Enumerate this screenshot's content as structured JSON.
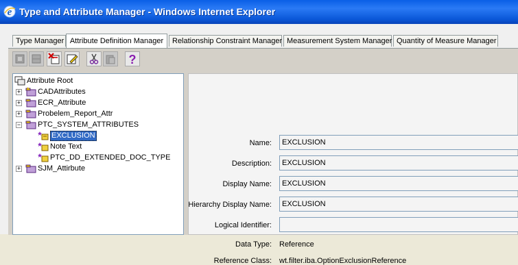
{
  "window": {
    "title": "Type and Attribute Manager - Windows Internet Explorer"
  },
  "tabs": [
    {
      "label": "Type Manager"
    },
    {
      "label": "Attribute Definition Manager"
    },
    {
      "label": "Relationship Constraint Manager"
    },
    {
      "label": "Measurement System Manager"
    },
    {
      "label": "Quantity of Measure Manager"
    }
  ],
  "active_tab": "Attribute Definition Manager",
  "toolbar": {
    "buttons": [
      {
        "icon": "new-attribute-icon",
        "enabled": false
      },
      {
        "icon": "new-organizer-icon",
        "enabled": false
      },
      {
        "icon": "delete-icon",
        "enabled": true
      },
      {
        "icon": "edit-icon",
        "enabled": true
      },
      {
        "icon": "cut-icon",
        "enabled": true
      },
      {
        "icon": "paste-icon",
        "enabled": false
      },
      {
        "icon": "help-icon",
        "enabled": true
      }
    ]
  },
  "tree": {
    "root": "Attribute Root",
    "items": [
      {
        "label": "CADAttributes"
      },
      {
        "label": "ECR_Attribute"
      },
      {
        "label": "Probelem_Report_Attr"
      },
      {
        "label": "PTC_SYSTEM_ATTRIBUTES"
      },
      {
        "label": "EXCLUSION"
      },
      {
        "label": "Note Text"
      },
      {
        "label": "PTC_DD_EXTENDED_DOC_TYPE"
      },
      {
        "label": "SJM_Attirbute"
      }
    ],
    "selected": "EXCLUSION"
  },
  "details": {
    "fields": [
      {
        "label": "Name:",
        "value": "EXCLUSION"
      },
      {
        "label": "Description:",
        "value": "EXCLUSION"
      },
      {
        "label": "Display Name:",
        "value": "EXCLUSION"
      },
      {
        "label": "Hierarchy Display Name:",
        "value": "EXCLUSION"
      },
      {
        "label": "Logical Identifier:",
        "value": ""
      },
      {
        "label": "Data Type:",
        "value": "Reference"
      },
      {
        "label": "Reference Class:",
        "value": "wt.filter.iba.OptionExclusionReference"
      }
    ]
  },
  "colors": {
    "titlebar": "#0a5fe6",
    "selection": "#316ac5",
    "panel": "#d4d0c8"
  }
}
